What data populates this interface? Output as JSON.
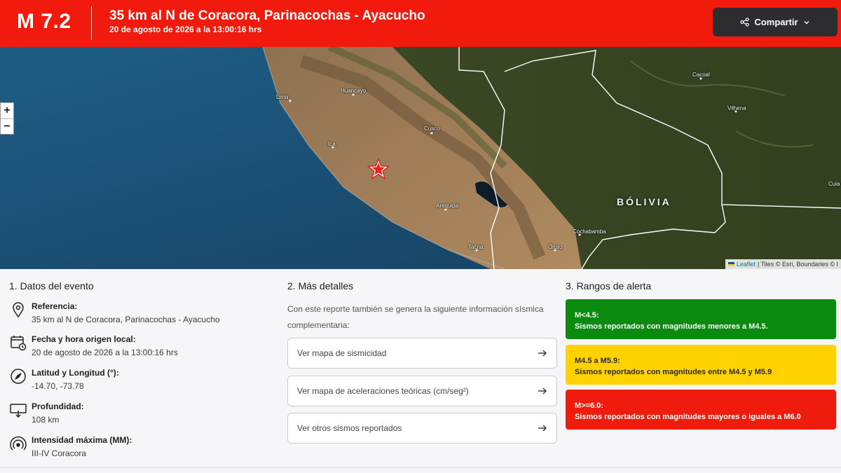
{
  "header": {
    "magnitude": "M 7.2",
    "title": "35 km al N de Coracora, Parinacochas - Ayacucho",
    "subtitle": "20 de agosto de 2026 a la 13:00:16 hrs",
    "share_label": "Compartir",
    "background_color": "#f21a0c"
  },
  "map": {
    "zoom_in": "+",
    "zoom_out": "−",
    "cities": [
      "Lima",
      "Huancayo",
      "Cusco",
      "Ica",
      "Arequipa",
      "Tacna",
      "Oruro",
      "Cochabamba",
      "Cacoal",
      "Vilhena",
      "Cuia"
    ],
    "country": "BÓLIVIA",
    "attribution": {
      "leaflet": "Leaflet",
      "tiles": "| Tiles © Esri, Boundaries © I"
    },
    "epicenter_icon": "star-icon"
  },
  "event": {
    "section_title": "1. Datos del evento",
    "items": [
      {
        "icon": "location-pin-icon",
        "label": "Referencia:",
        "value": "35 km al N de Coracora, Parinacochas - Ayacucho"
      },
      {
        "icon": "calendar-clock-icon",
        "label": "Fecha y hora origen local:",
        "value": "20 de agosto de 2026 a la 13:00:16 hrs"
      },
      {
        "icon": "compass-icon",
        "label": "Latitud y Longitud (°):",
        "value": "-14.70, -73.78"
      },
      {
        "icon": "depth-icon",
        "label": "Profundidad:",
        "value": "108 km"
      },
      {
        "icon": "signal-waves-icon",
        "label": "Intensidad máxima (MM):",
        "value": "III-IV Coracora"
      }
    ]
  },
  "details": {
    "section_title": "2. Más detalles",
    "intro": "Con este reporte también se genera la siguiente información sísmica complementaria:",
    "links": [
      "Ver mapa de sismicidad",
      "Ver mapa de aceleraciones teóricas (cm/seg²)",
      "Ver otros sismos reportados"
    ]
  },
  "alerts": {
    "section_title": "3. Rangos de alerta",
    "ranges": [
      {
        "title": "M<4.5:",
        "description": "Sismos reportados con magnitudes menores a M4.5.",
        "color": "#0a8a0f"
      },
      {
        "title": "M4.5 a M5.9:",
        "description": "Sismos reportados con magnitudes entre M4.5 y M5.9",
        "color": "#ffd200"
      },
      {
        "title": "M>=6.0:",
        "description": "Sismos reportados con magnitudes mayores o iguales a M6.0",
        "color": "#ef1c0e"
      }
    ]
  }
}
